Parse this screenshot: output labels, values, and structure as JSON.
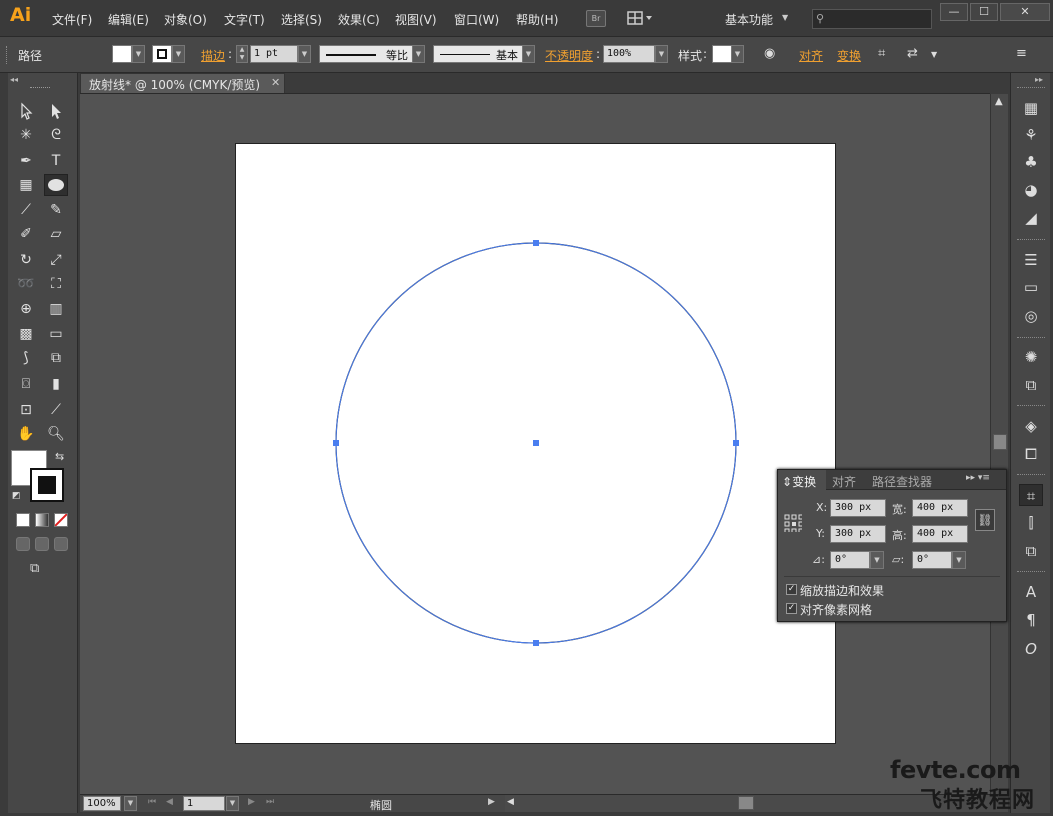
{
  "app": {
    "logo": "Ai",
    "menus": [
      "文件(F)",
      "编辑(E)",
      "对象(O)",
      "文字(T)",
      "选择(S)",
      "效果(C)",
      "视图(V)",
      "窗口(W)",
      "帮助(H)"
    ],
    "bridge_label": "Br",
    "workspace": "基本功能",
    "window_buttons": [
      "—",
      "☐",
      "✕"
    ]
  },
  "control_bar": {
    "object_type": "路径",
    "stroke_label": "描边",
    "stroke_weight": "1 pt",
    "stroke_profile_1": "等比",
    "stroke_profile_2": "基本",
    "opacity_label": "不透明度",
    "opacity_value": "100%",
    "style_label": "样式",
    "align_label": "对齐",
    "transform_label": "变换"
  },
  "document": {
    "tab_title": "放射线* @ 100% (CMYK/预览)",
    "tab_close": "✕"
  },
  "transform_panel": {
    "tabs": [
      "变换",
      "对齐",
      "路径查找器"
    ],
    "x_label": "X:",
    "x_value": "300 px",
    "y_label": "Y:",
    "y_value": "300 px",
    "w_label": "宽:",
    "w_value": "400 px",
    "h_label": "高:",
    "h_value": "400 px",
    "rotate_value": "0°",
    "shear_value": "0°",
    "check_scale_strokes": "缩放描边和效果",
    "check_align_pixel": "对齐像素网格",
    "scale_strokes_checked": true,
    "align_pixel_checked": true
  },
  "status_bar": {
    "zoom": "100%",
    "artboard_index": "1",
    "current_tool": "椭圆"
  },
  "watermark": {
    "line1": "fevte.com",
    "line2": "飞特教程网"
  },
  "colors": {
    "selection_blue": "#4a7ef0",
    "accent_orange": "#f0a030",
    "artboard": "#ffffff",
    "canvas_bg": "#535353"
  }
}
